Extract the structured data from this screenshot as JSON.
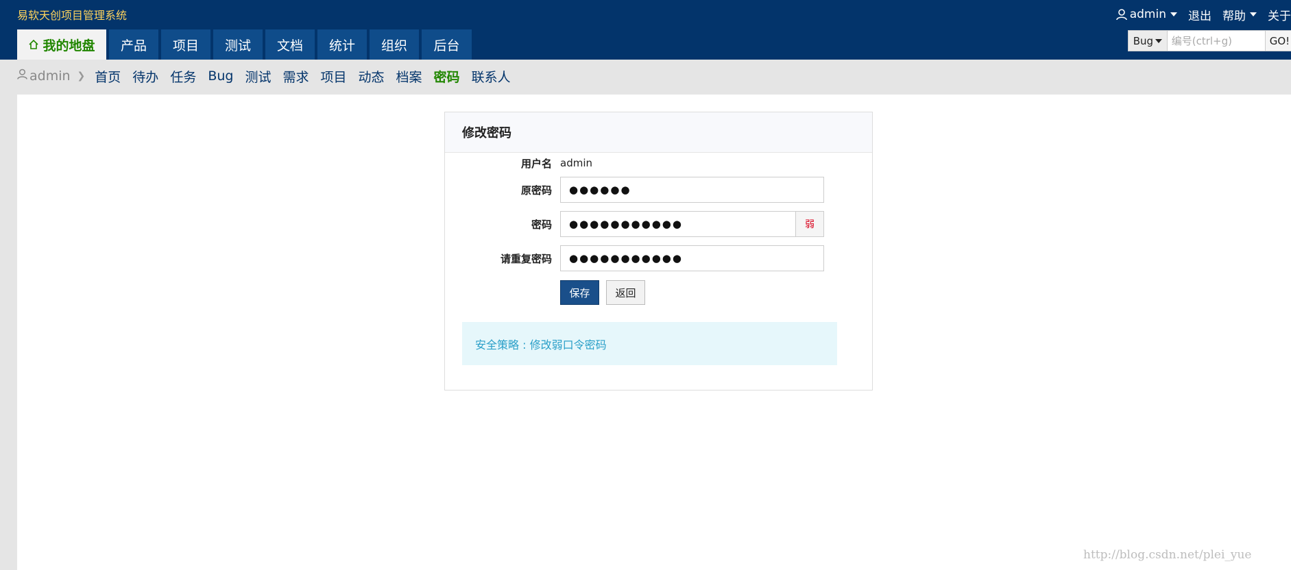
{
  "header": {
    "app_title": "易软天创项目管理系统",
    "user_menu": "admin",
    "logout": "退出",
    "help": "帮助",
    "about": "关于"
  },
  "main_nav": [
    {
      "label": "我的地盘",
      "active": true
    },
    {
      "label": "产品"
    },
    {
      "label": "项目"
    },
    {
      "label": "测试"
    },
    {
      "label": "文档"
    },
    {
      "label": "统计"
    },
    {
      "label": "组织"
    },
    {
      "label": "后台"
    }
  ],
  "search": {
    "type": "Bug",
    "placeholder": "编号(ctrl+g)",
    "go": "GO!"
  },
  "sub_nav": {
    "user": "admin",
    "links": [
      "首页",
      "待办",
      "任务",
      "Bug",
      "测试",
      "需求",
      "项目",
      "动态",
      "档案",
      "密码",
      "联系人"
    ],
    "active": "密码"
  },
  "panel": {
    "title": "修改密码",
    "username_label": "用户名",
    "username_value": "admin",
    "old_password_label": "原密码",
    "old_password_value": "●●●●●●",
    "password_label": "密码",
    "password_value": "●●●●●●●●●●●",
    "strength": "弱",
    "repeat_label": "请重复密码",
    "repeat_value": "●●●●●●●●●●●",
    "save": "保存",
    "back": "返回",
    "policy": "安全策略 : 修改弱口令密码"
  },
  "watermark": "http://blog.csdn.net/plei_yue",
  "colors": {
    "header_bg": "#03346b",
    "title_yellow": "#ffd35c",
    "active_green": "#218600",
    "primary_button": "#1a4f8a",
    "weak_red": "#d9001b",
    "policy_text": "#2a9fc8"
  }
}
